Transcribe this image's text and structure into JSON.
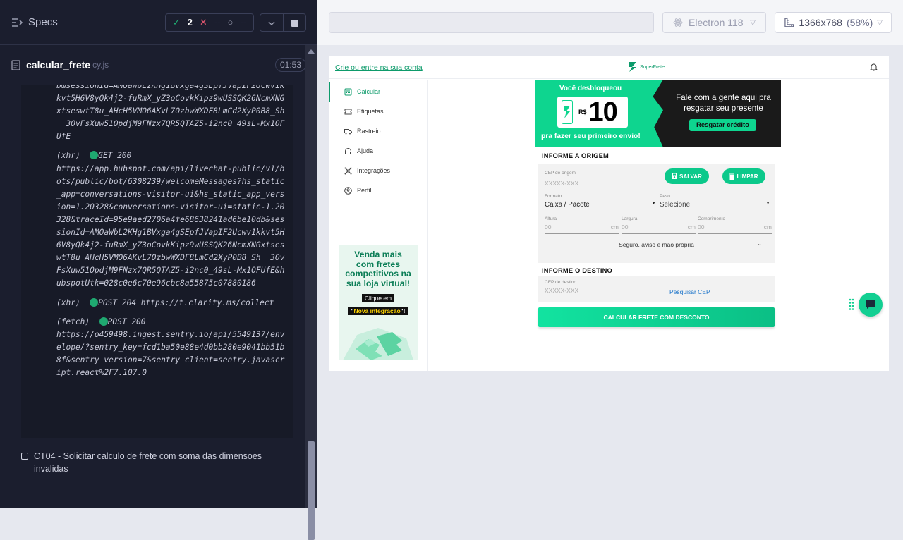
{
  "reporter": {
    "specs_label": "Specs",
    "stats": {
      "passed": "2",
      "failed": "--",
      "pending": "--"
    },
    "spec": {
      "name": "calcular_frete",
      "ext": "cy.js",
      "duration": "01:53"
    },
    "log_entries": [
      {
        "text": "b&sessionId=AMOaWbL2KHg1BVxga4gSEpfJVapIF2Ucwv1kkvt5H6V8yQk4j2-fuRmX_yZ3oCovkKipz9wUSSQK26NcmXNGxtseswtT8u_AHcH5VMO6AKvL7OzbwWXDF8LmCd2XyP0B8_Sh__3OvFsXuw51OpdjM9FNzx7QR5QTAZ5-i2nc0_49sL-Mx1OFUfE"
      },
      {
        "prefix": "(xhr)",
        "method": "GET 200",
        "text": "https://app.hubspot.com/api/livechat-public/v1/bots/public/bot/6308239/welcomeMessages?hs_static_app=conversations-visitor-ui&hs_static_app_version=1.20328&conversations-visitor-ui=static-1.20328&traceId=95e9aed2706a4fe68638241ad6be10db&sessionId=AMOaWbL2KHg1BVxga4gSEpfJVapIF2Ucwv1kkvt5H6V8yQk4j2-fuRmX_yZ3oCovkKipz9wUSSQK26NcmXNGxtseswtT8u_AHcH5VMO6AKvL7OzbwWXDF8LmCd2XyP0B8_Sh__3OvFsXuw51OpdjM9FNzx7QR5QTAZ5-i2nc0_49sL-Mx1OFUfE&hubspotUtk=028c0e6c70e96cbc8a55875c07880186"
      },
      {
        "prefix": "(xhr)",
        "method": "POST 204 https://t.clarity.ms/collect",
        "text": ""
      },
      {
        "prefix": "(fetch)",
        "method": "POST 200",
        "text": "https://o459498.ingest.sentry.io/api/5549137/envelope/?sentry_key=fcd1ba50e88e4d0bb280e9041bb51b8f&sentry_version=7&sentry_client=sentry.javascript.react%2F7.107.0"
      }
    ],
    "test_title": "CT04 - Solicitar calculo de frete com soma das dimensoes invalidas"
  },
  "aut": {
    "url": "",
    "browser": "Electron 118",
    "viewport": "1366x768",
    "scale": "(58%)"
  },
  "app": {
    "login_link": "Crie ou entre na sua conta",
    "logo_text": "SuperFrete",
    "sidebar": [
      {
        "label": "Calcular",
        "icon": "calculator-icon",
        "active": true
      },
      {
        "label": "Etiquetas",
        "icon": "ticket-icon",
        "active": false
      },
      {
        "label": "Rastreio",
        "icon": "truck-icon",
        "active": false
      },
      {
        "label": "Ajuda",
        "icon": "help-icon",
        "active": false
      },
      {
        "label": "Integrações",
        "icon": "integrations-icon",
        "active": false
      },
      {
        "label": "Perfil",
        "icon": "profile-icon",
        "active": false
      }
    ],
    "ad": {
      "title": "Venda mais com fretes competitivos na sua loja virtual!",
      "cta_line1": "Clique em",
      "cta_line2_open": "\"",
      "cta_line2_hl": "Nova integração",
      "cta_line2_close": "\"!"
    },
    "banner": {
      "top": "Você desbloqueou",
      "currency": "R$",
      "value": "10",
      "bottom": "pra fazer seu primeiro envio!",
      "right": "Fale com a gente aqui pra resgatar seu presente",
      "button": "Resgatar crédito"
    },
    "origin": {
      "title": "INFORME A ORIGEM",
      "cep_label": "CEP de origem",
      "cep_placeholder": "XXXXX-XXX",
      "save": "SALVAR",
      "clear": "LIMPAR",
      "format_label": "Formato",
      "format_value": "Caixa / Pacote",
      "weight_label": "Peso",
      "weight_value": "Selecione",
      "height_label": "Altura",
      "width_label": "Largura",
      "length_label": "Comprimento",
      "dim_placeholder": "00",
      "unit": "cm",
      "extras": "Seguro, aviso e mão própria"
    },
    "destination": {
      "title": "INFORME O DESTINO",
      "cep_label": "CEP de destino",
      "cep_placeholder": "XXXXX-XXX",
      "search_cep": "Pesquisar CEP"
    },
    "calc_button": "CALCULAR FRETE COM DESCONTO",
    "colors": {
      "brand": "#0d9b6b",
      "accent": "#0ed58f",
      "dark": "#1a1a1a"
    }
  }
}
